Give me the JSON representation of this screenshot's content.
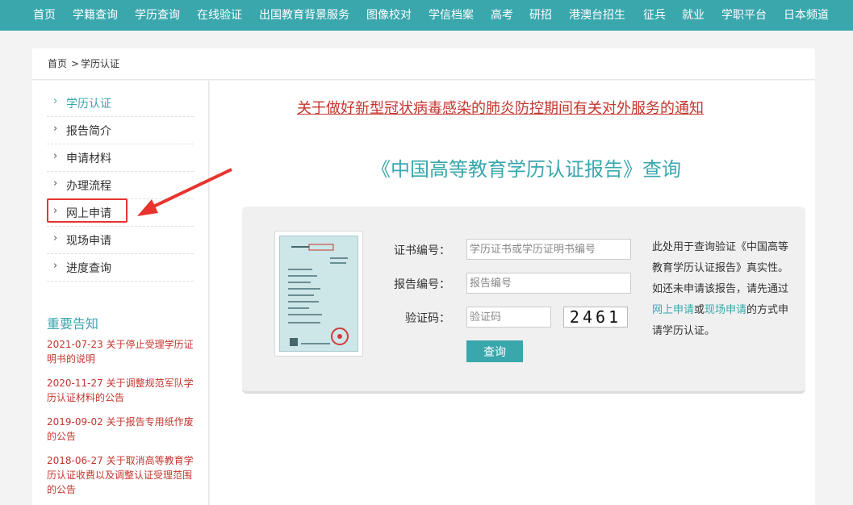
{
  "topnav": {
    "items": [
      "首页",
      "学籍查询",
      "学历查询",
      "在线验证",
      "出国教育背景服务",
      "图像校对",
      "学信档案",
      "高考",
      "研招",
      "港澳台招生",
      "征兵",
      "就业",
      "学职平台",
      "日本频道"
    ]
  },
  "breadcrumb": {
    "home": "首页",
    "sep": ">",
    "current": "学历认证"
  },
  "sidebar": {
    "items": [
      {
        "label": "学历认证"
      },
      {
        "label": "报告简介"
      },
      {
        "label": "申请材料"
      },
      {
        "label": "办理流程"
      },
      {
        "label": "网上申请"
      },
      {
        "label": "现场申请"
      },
      {
        "label": "进度查询"
      }
    ],
    "chevron": "›",
    "notices_title": "重要告知",
    "notices": [
      {
        "date": "2021-07-23",
        "text": "关于停止受理学历证明书的说明"
      },
      {
        "date": "2020-11-27",
        "text": "关于调整规范军队学历认证材料的公告"
      },
      {
        "date": "2019-09-02",
        "text": "关于报告专用纸作废的公告"
      },
      {
        "date": "2018-06-27",
        "text": "关于取消高等教育学历认证收费以及调整认证受理范围的公告"
      }
    ]
  },
  "main": {
    "banner": "关于做好新型冠状病毒感染的肺炎防控期间有关对外服务的通知",
    "query_title": "《中国高等教育学历认证报告》查询",
    "form": {
      "cert_label": "证书编号：",
      "cert_placeholder": "学历证书或学历证明书编号",
      "report_label": "报告编号：",
      "report_placeholder": "报告编号",
      "captcha_label": "验证码：",
      "captcha_placeholder": "验证码",
      "captcha_text": "2461",
      "submit": "查询"
    },
    "help": {
      "before": "此处用于查询验证《中国高等教育学历认证报告》真实性。如还未申请该报告，请先通过",
      "link1": "网上申请",
      "mid": "或",
      "link2": "现场申请",
      "after": "的方式申请学历认证。"
    }
  },
  "colors": {
    "accent": "#3aa7ad",
    "red": "#c4362e",
    "highlight": "#e8332f"
  }
}
